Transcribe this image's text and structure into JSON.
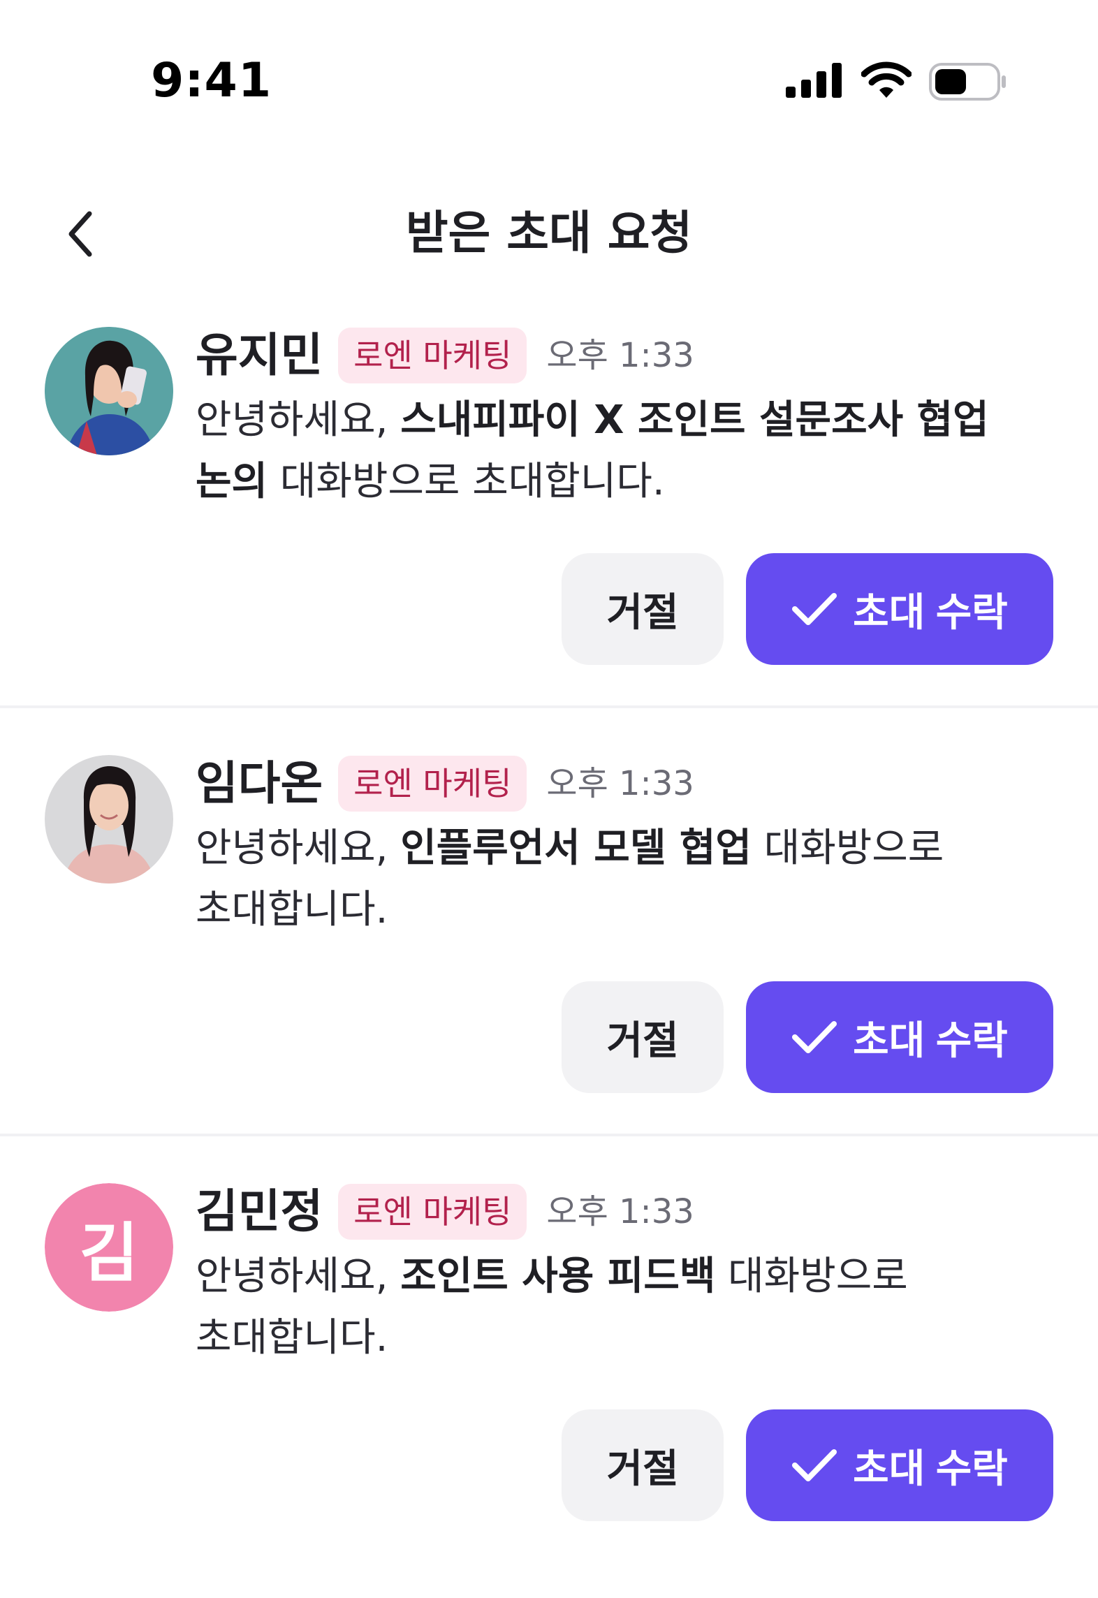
{
  "status_bar": {
    "time": "9:41",
    "icons": [
      "signal-icon",
      "wifi-icon",
      "battery-icon"
    ]
  },
  "header": {
    "title": "받은 초대 요청",
    "back_icon": "chevron-left-icon"
  },
  "colors": {
    "accent": "#654cf0",
    "badge_bg": "#fde7ee",
    "badge_text": "#b2214c",
    "decline_bg": "#f2f2f4",
    "avatar_initial_bg": "#f284ad"
  },
  "invites": [
    {
      "name": "유지민",
      "team": "로엔 마케팅",
      "time": "오후 1:33",
      "message_prefix": "안녕하세요, ",
      "room": "스내피파이 X 조인트 설문조사 협업 논의",
      "message_suffix": " 대화방으로 초대합니다.",
      "decline_label": "거절",
      "accept_label": "초대 수락",
      "avatar": "photo"
    },
    {
      "name": "임다온",
      "team": "로엔 마케팅",
      "time": "오후 1:33",
      "message_prefix": "안녕하세요, ",
      "room": "인플루언서 모델 협업",
      "message_suffix": " 대화방으로 초대합니다.",
      "decline_label": "거절",
      "accept_label": "초대 수락",
      "avatar": "photo"
    },
    {
      "name": "김민정",
      "team": "로엔 마케팅",
      "time": "오후 1:33",
      "message_prefix": "안녕하세요, ",
      "room": "조인트 사용 피드백",
      "message_suffix": " 대화방으로 초대합니다.",
      "decline_label": "거절",
      "accept_label": "초대 수락",
      "avatar": "initial",
      "avatar_initial": "김"
    }
  ]
}
